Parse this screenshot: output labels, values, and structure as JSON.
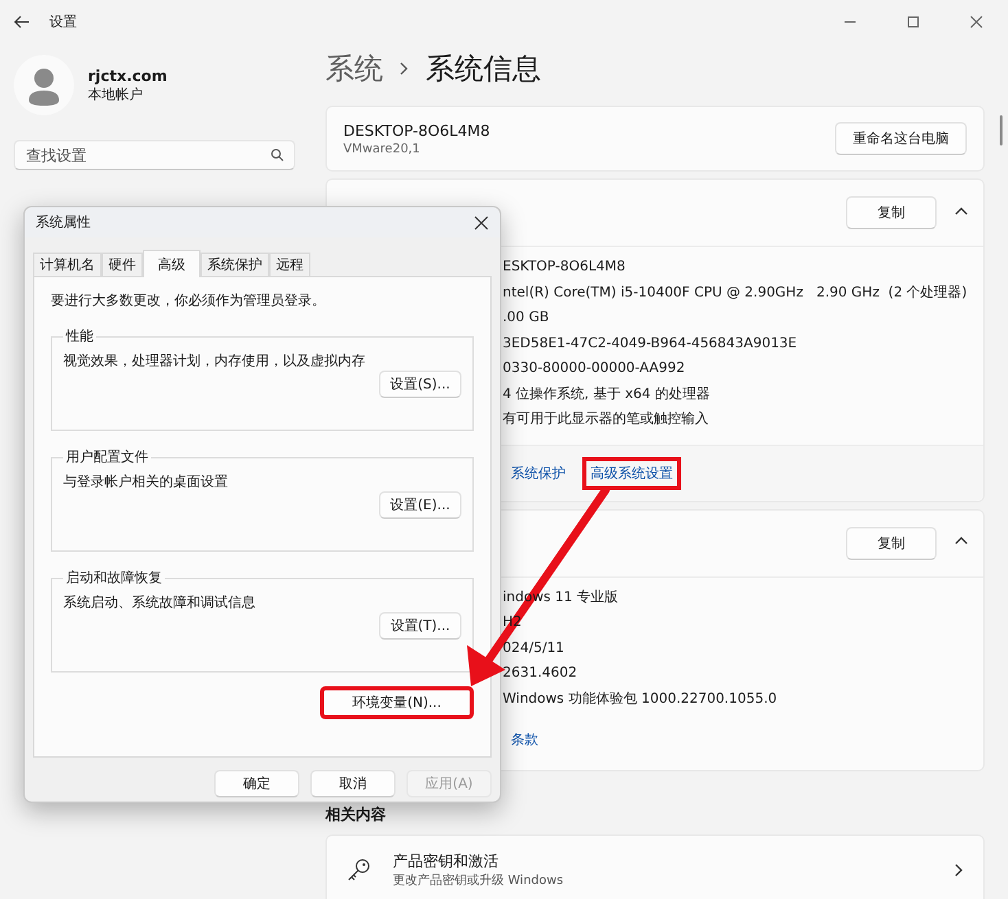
{
  "window": {
    "title": "设置"
  },
  "account": {
    "name": "rjctx.com",
    "type": "本地帐户"
  },
  "search": {
    "placeholder": "查找设置"
  },
  "breadcrumb": [
    "系统",
    "系统信息"
  ],
  "device": {
    "name": "DESKTOP-8O6L4M8",
    "model": "VMware20,1",
    "rename_button": "重命名这台电脑"
  },
  "device_specs": {
    "copy_button": "复制",
    "expanded": true,
    "values": [
      "ESKTOP-8O6L4M8",
      "ntel(R) Core(TM) i5-10400F CPU @ 2.90GHz   2.90 GHz  (2 个处理器)",
      ".00 GB",
      "3ED58E1-47C2-4049-B964-456843A9013E",
      "0330-80000-00000-AA992",
      "4 位操作系统, 基于 x64 的处理器",
      "有可用于此显示器的笔或触控输入"
    ],
    "links": [
      {
        "label": "系统保护",
        "highlighted": false
      },
      {
        "label": "高级系统设置",
        "highlighted": true
      }
    ]
  },
  "windows_specs": {
    "copy_button": "复制",
    "expanded": true,
    "values": [
      "indows 11 专业版",
      "H2",
      "024/5/11",
      "2631.4602",
      "Windows 功能体验包 1000.22700.1055.0"
    ],
    "links": [
      {
        "label": "条款",
        "highlighted": false
      }
    ]
  },
  "related": {
    "title": "相关内容",
    "items": [
      {
        "title": "产品密钥和激活",
        "subtitle": "更改产品密钥或升级 Windows"
      }
    ]
  },
  "dialog": {
    "title": "系统属性",
    "tabs": [
      {
        "label": "计算机名",
        "selected": false
      },
      {
        "label": "硬件",
        "selected": false
      },
      {
        "label": "高级",
        "selected": true
      },
      {
        "label": "系统保护",
        "selected": false
      },
      {
        "label": "远程",
        "selected": false
      }
    ],
    "notice": "要进行大多数更改，你必须作为管理员登录。",
    "groups": [
      {
        "title": "性能",
        "description": "视觉效果，处理器计划，内存使用，以及虚拟内存",
        "button": "设置(S)..."
      },
      {
        "title": "用户配置文件",
        "description": "与登录帐户相关的桌面设置",
        "button": "设置(E)..."
      },
      {
        "title": "启动和故障恢复",
        "description": "系统启动、系统故障和调试信息",
        "button": "设置(T)..."
      }
    ],
    "env_button": {
      "label": "环境变量(N)...",
      "highlighted": true
    },
    "buttons": [
      {
        "label": "确定",
        "disabled": false
      },
      {
        "label": "取消",
        "disabled": false
      },
      {
        "label": "应用(A)",
        "disabled": true
      }
    ]
  }
}
